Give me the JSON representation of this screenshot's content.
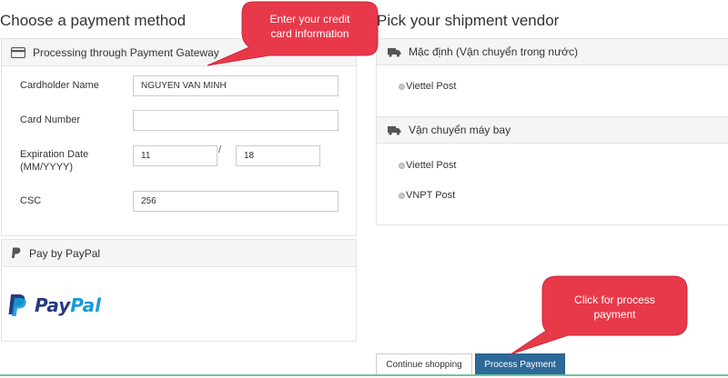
{
  "payment": {
    "heading": "Choose a payment method",
    "gateway": {
      "title": "Processing through Payment Gateway",
      "cardholder_label": "Cardholder Name",
      "cardholder_value": "NGUYEN VAN MINH",
      "card_number_label": "Card Number",
      "card_number_value": "",
      "expiry_label_1": "Expiration Date",
      "expiry_label_2": "(MM/YYYY)",
      "expiry_month": "11",
      "expiry_separator": "/",
      "expiry_year": "18",
      "csc_label": "CSC",
      "csc_value": "256"
    },
    "paypal": {
      "title": "Pay by PayPal",
      "logo_text_1": "Pay",
      "logo_text_2": "Pal"
    }
  },
  "shipment": {
    "heading": "Pick your shipment vendor",
    "groups": [
      {
        "title": "Mặc định (Vận chuyển trong nước)",
        "options": [
          "Viettel Post"
        ]
      },
      {
        "title": "Vận chuyển máy bay",
        "options": [
          "Viettel Post",
          "VNPT Post"
        ]
      }
    ]
  },
  "actions": {
    "continue_label": "Continue shopping",
    "process_label": "Process Payment"
  },
  "callouts": {
    "credit_card": [
      "Enter your credit",
      "card information"
    ],
    "process": [
      "Click for process",
      "payment"
    ]
  },
  "colors": {
    "callout": "#e8394a",
    "primary_button": "#2d6a99",
    "paypal_dark": "#253b80",
    "paypal_light": "#179bd7",
    "bottom_line": "#6fc49c"
  }
}
